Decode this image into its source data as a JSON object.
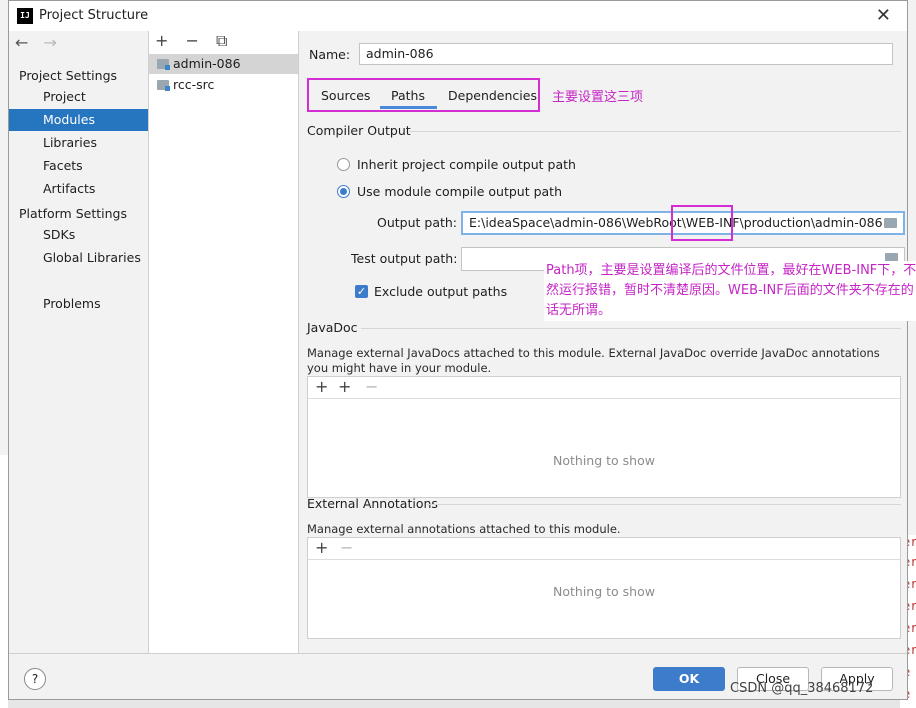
{
  "window": {
    "title": "Project Structure",
    "icon_text": "IJ"
  },
  "nav": {
    "back_icon": "←",
    "forward_icon": "→",
    "project_settings_header": "Project Settings",
    "project_settings_items": [
      "Project",
      "Modules",
      "Libraries",
      "Facets",
      "Artifacts"
    ],
    "platform_settings_header": "Platform Settings",
    "platform_settings_items": [
      "SDKs",
      "Global Libraries"
    ],
    "problems": "Problems",
    "selected": "Modules"
  },
  "modules": {
    "toolbar": {
      "add": "+",
      "remove": "−",
      "copy": "⧉"
    },
    "items": [
      "admin-086",
      "rcc-src"
    ],
    "selected": "admin-086"
  },
  "module_detail": {
    "name_label": "Name:",
    "name_value": "admin-086",
    "tabs": [
      "Sources",
      "Paths",
      "Dependencies"
    ],
    "active_tab": "Paths",
    "tabs_annotation": "主要设置这三项",
    "compiler_output": {
      "title": "Compiler Output",
      "inherit_label": "Inherit project compile output path",
      "use_module_label": "Use module compile output path",
      "selected": "use_module",
      "output_path_label": "Output path:",
      "output_path_value": "E:\\ideaSpace\\admin-086\\WebRoot\\WEB-INF\\production\\admin-086",
      "test_output_path_label": "Test output path:",
      "test_output_path_value": "",
      "exclude_label": "Exclude output paths",
      "exclude_checked": true,
      "paths_annotation": "Path项，主要是设置编译后的文件位置，最好在WEB-INF下，不然运行报错，暂时不清楚原因。WEB-INF后面的文件夹不存在的话无所谓。"
    },
    "javadoc": {
      "title": "JavaDoc",
      "description": "Manage external JavaDocs attached to this module. External JavaDoc override JavaDoc annotations you might have in your module.",
      "toolbar": {
        "add": "+",
        "add_url": "+",
        "remove": "−"
      },
      "empty_text": "Nothing to show"
    },
    "external_annotations": {
      "title": "External Annotations",
      "description": "Manage external annotations attached to this module.",
      "toolbar": {
        "add": "+",
        "remove": "−"
      },
      "empty_text": "Nothing to show"
    }
  },
  "buttons": {
    "help": "?",
    "ok": "OK",
    "close": "Close",
    "apply": "Apply"
  },
  "watermark": "CSDN @qq_38468172",
  "background_glyphs": [
    "er",
    "er",
    "er",
    "er",
    "er",
    "er",
    "e",
    "e"
  ]
}
